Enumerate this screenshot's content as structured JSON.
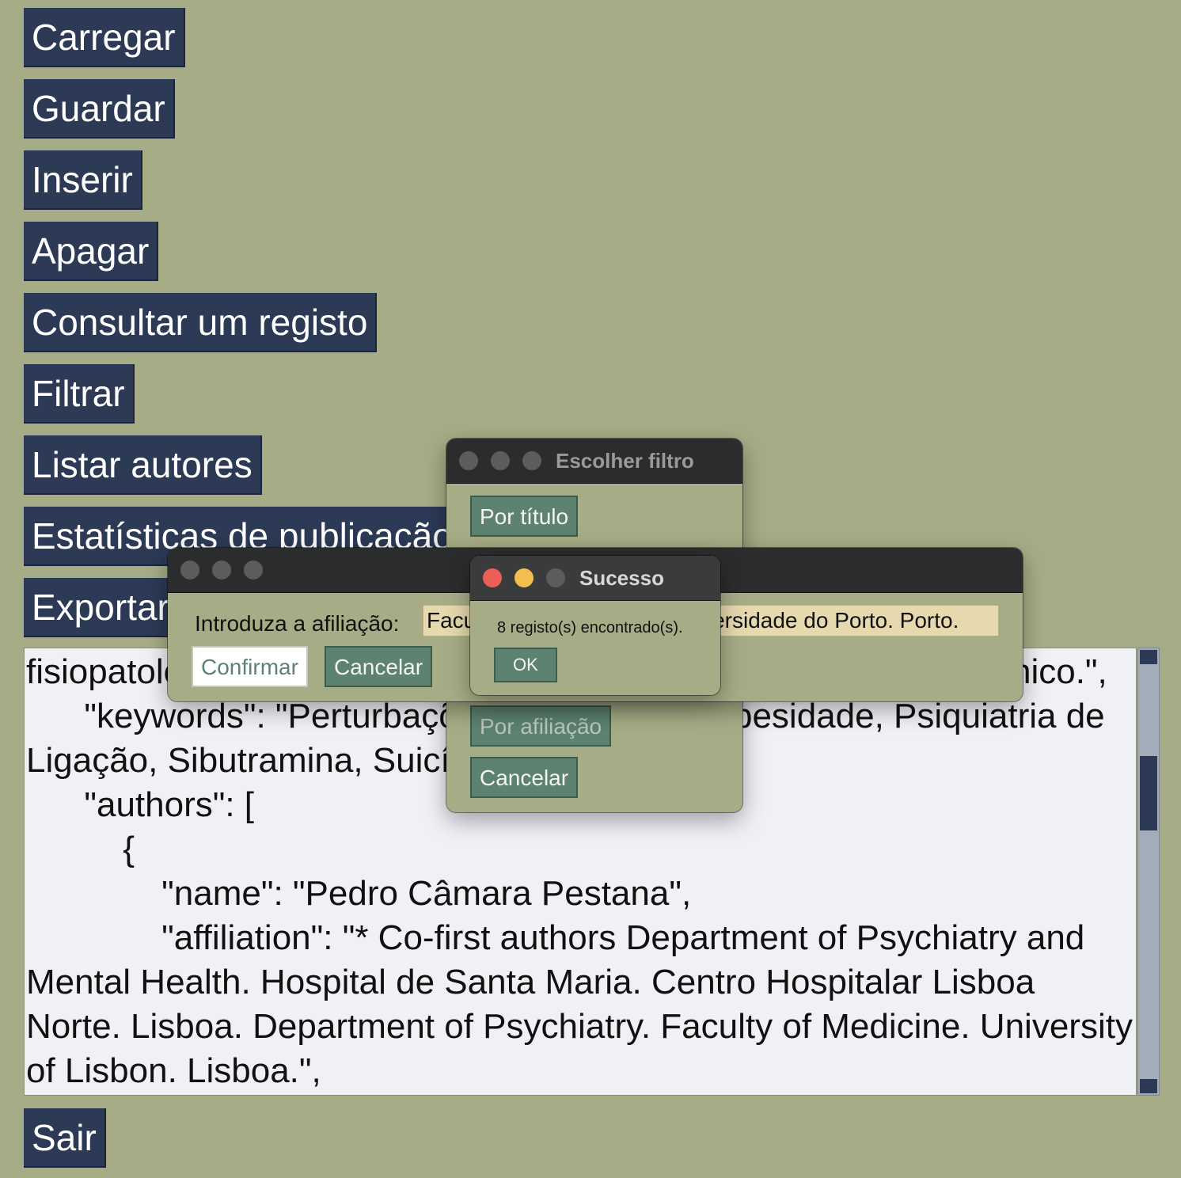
{
  "main_buttons": {
    "load": "Carregar",
    "save": "Guardar",
    "insert": "Inserir",
    "delete": "Apagar",
    "consult": "Consultar um registo",
    "filter": "Filtrar",
    "list_authors": "Listar autores",
    "stats": "Estatísticas de publicação",
    "export": "Exportar",
    "exit": "Sair"
  },
  "text_area": {
    "content": "fisiopatologia e tratamento da obesidade através de um caso clínico.\",\n      \"keywords\": \"Perturbações Alimentares, Obesidade, Psiquiatria de Ligação, Sibutramina, Suicídio\",\n      \"authors\": [\n          {\n              \"name\": \"Pedro Câmara Pestana\",\n              \"affiliation\": \"* Co-first authors Department of Psychiatry and Mental Health. Hospital de Santa Maria. Centro Hospitalar Lisboa Norte. Lisboa. Department of Psychiatry. Faculty of Medicine. University of Lisbon. Lisboa.\","
  },
  "filter_dialog": {
    "title": "Escolher filtro",
    "by_title": "Por título",
    "by_affiliation": "Por afiliação",
    "cancel": "Cancelar"
  },
  "affiliation_dialog": {
    "prompt": "Introduza a afiliação:",
    "input_value": "Faculdade de Medicina. Universidade do Porto. Porto.",
    "confirm": "Confirmar",
    "cancel": "Cancelar"
  },
  "success_dialog": {
    "title": "Sucesso",
    "message": "8 registo(s) encontrado(s).",
    "ok": "OK"
  },
  "colors": {
    "background": "#a6ad86",
    "button_navy": "#2c3a56",
    "dialog_button": "#5d826f",
    "input_bg": "#e6d9ae",
    "close_red": "#ec5f57",
    "minimize_yellow": "#f4bd4f"
  }
}
